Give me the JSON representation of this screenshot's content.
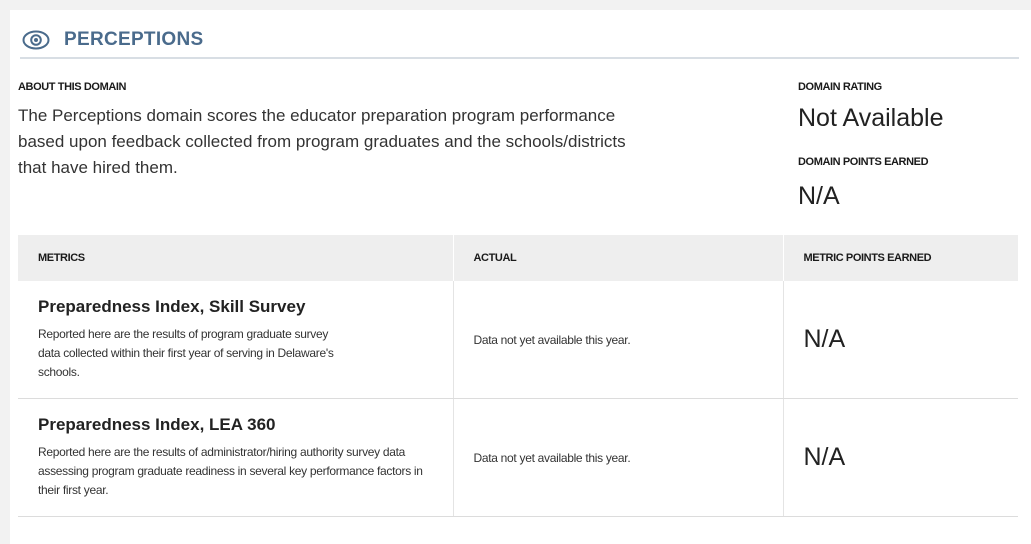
{
  "section": {
    "title": "PERCEPTIONS",
    "icon": "eye-icon",
    "accent_color": "#4a6b8c"
  },
  "about": {
    "label": "ABOUT THIS DOMAIN",
    "text": "The Perceptions domain scores the educator preparation program performance based upon feedback collected from program graduates and the schools/districts that have hired them."
  },
  "rating": {
    "label": "DOMAIN RATING",
    "value": "Not Available"
  },
  "points": {
    "label": "DOMAIN POINTS EARNED",
    "value": "N/A"
  },
  "table": {
    "headers": [
      "METRICS",
      "ACTUAL",
      "METRIC POINTS EARNED"
    ],
    "rows": [
      {
        "name": "Preparedness Index, Skill Survey",
        "description": "Reported here are the results of program graduate survey data collected within their first year of serving in Delaware's schools.",
        "actual": "Data not yet available this year.",
        "points": "N/A"
      },
      {
        "name": "Preparedness Index, LEA 360",
        "description": "Reported here are the results of administrator/hiring authority survey data assessing program graduate readiness in several key performance factors in their first year.",
        "actual": "Data not yet available this year.",
        "points": "N/A"
      }
    ]
  }
}
